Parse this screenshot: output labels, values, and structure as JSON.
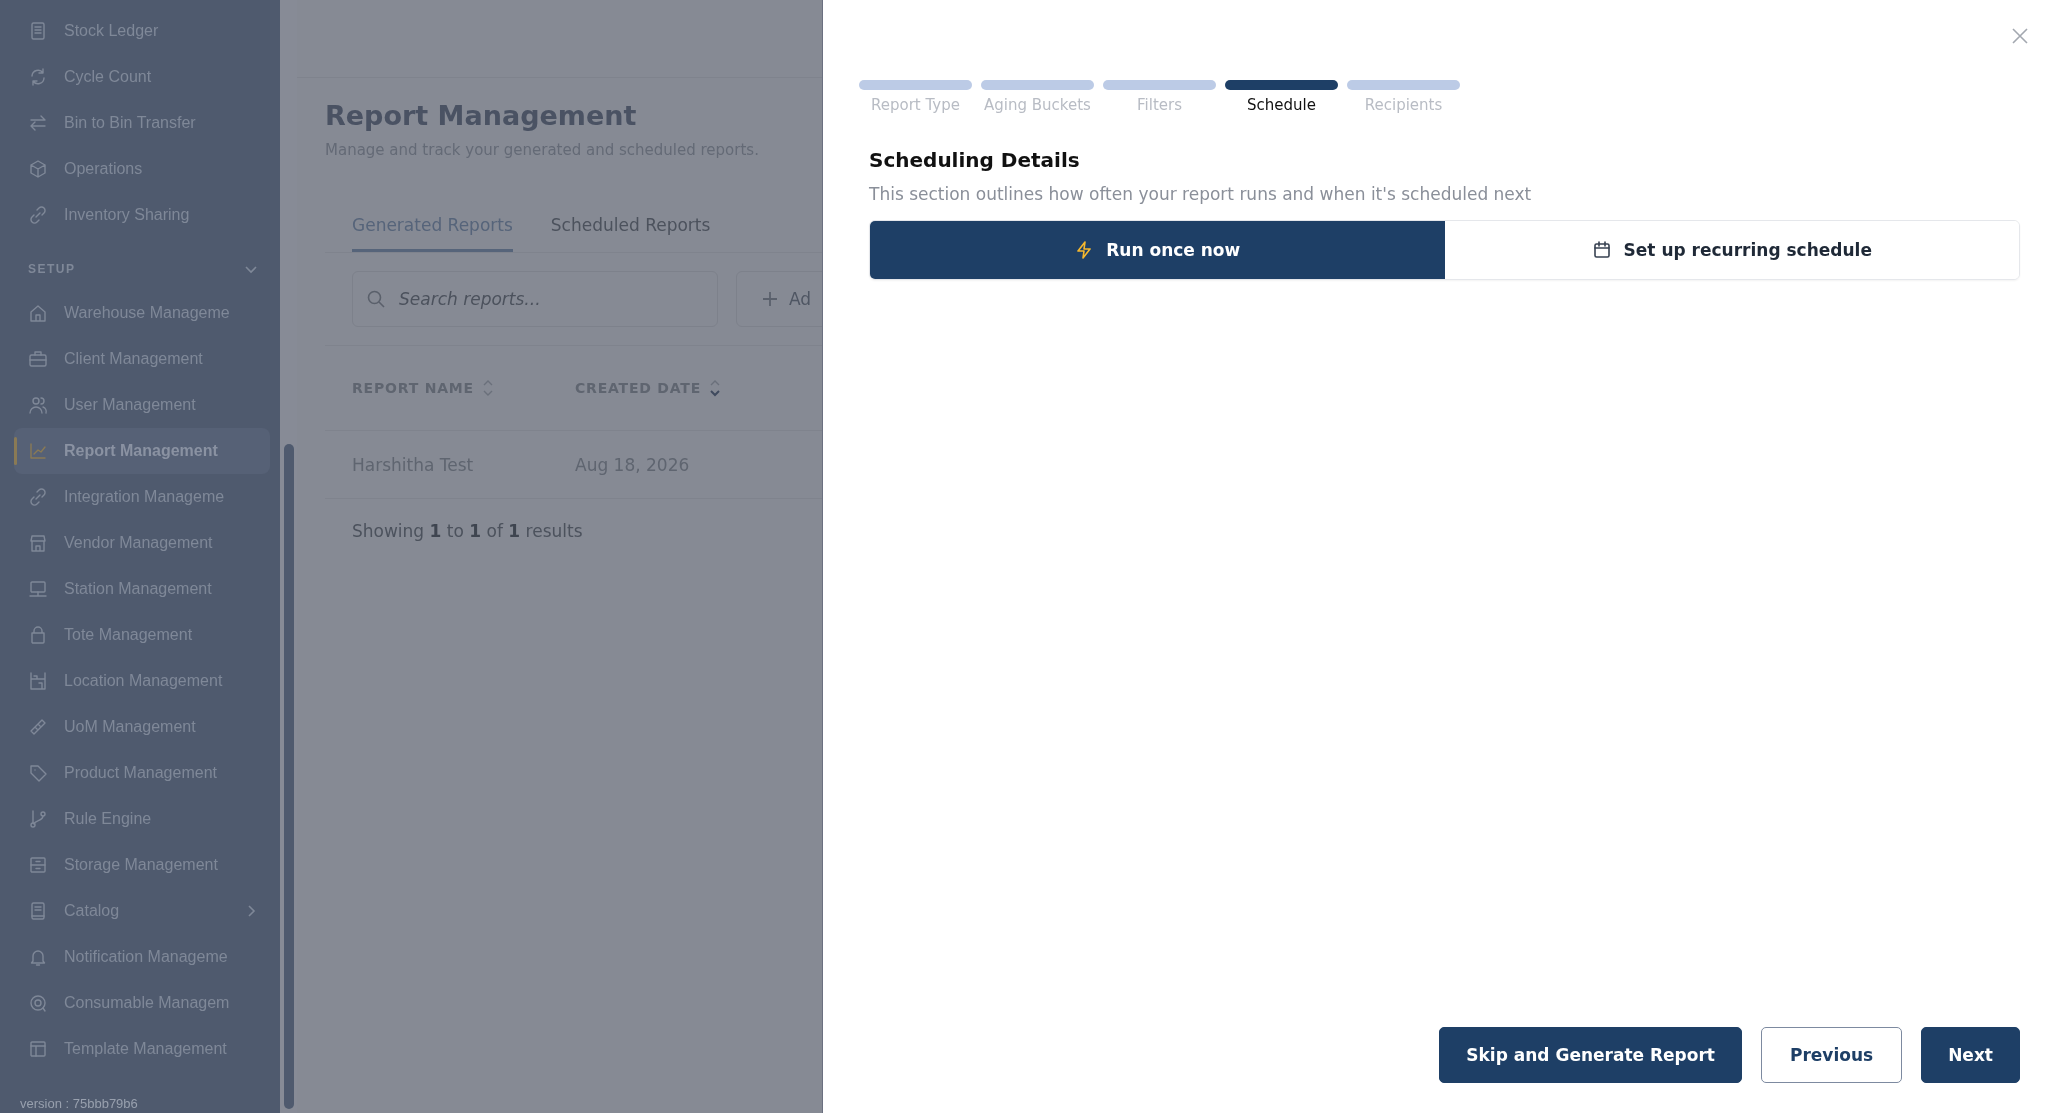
{
  "sidebar": {
    "sections": [
      {
        "items": [
          {
            "label": "Stock Ledger",
            "selected": false,
            "expandable": false
          },
          {
            "label": "Cycle Count",
            "selected": false,
            "expandable": false
          },
          {
            "label": "Bin to Bin Transfer",
            "selected": false,
            "expandable": false
          },
          {
            "label": "Operations",
            "selected": false,
            "expandable": false
          },
          {
            "label": "Inventory Sharing",
            "selected": false,
            "expandable": false
          }
        ]
      },
      {
        "title": "SETUP",
        "expanded": true,
        "items": [
          {
            "label": "Warehouse Manageme",
            "selected": false,
            "expandable": false
          },
          {
            "label": "Client Management",
            "selected": false,
            "expandable": false
          },
          {
            "label": "User Management",
            "selected": false,
            "expandable": false
          },
          {
            "label": "Report Management",
            "selected": true,
            "expandable": false
          },
          {
            "label": "Integration Manageme",
            "selected": false,
            "expandable": false
          },
          {
            "label": "Vendor Management",
            "selected": false,
            "expandable": false
          },
          {
            "label": "Station Management",
            "selected": false,
            "expandable": false
          },
          {
            "label": "Tote Management",
            "selected": false,
            "expandable": false
          },
          {
            "label": "Location Management",
            "selected": false,
            "expandable": false
          },
          {
            "label": "UoM Management",
            "selected": false,
            "expandable": false
          },
          {
            "label": "Product Management",
            "selected": false,
            "expandable": false
          },
          {
            "label": "Rule Engine",
            "selected": false,
            "expandable": false
          },
          {
            "label": "Storage Management",
            "selected": false,
            "expandable": false
          },
          {
            "label": "Catalog",
            "selected": false,
            "expandable": true
          },
          {
            "label": "Notification Manageme",
            "selected": false,
            "expandable": false
          },
          {
            "label": "Consumable Managem",
            "selected": false,
            "expandable": false
          },
          {
            "label": "Template Management",
            "selected": false,
            "expandable": false
          }
        ]
      }
    ],
    "version": "version : 75bbb79b6"
  },
  "page": {
    "title": "Report Management",
    "subtitle": "Manage and track your generated and scheduled reports.",
    "tabs": [
      {
        "label": "Generated Reports",
        "selected": true
      },
      {
        "label": "Scheduled Reports",
        "selected": false
      }
    ],
    "search": {
      "placeholder": "Search reports..."
    },
    "add_button": "Ad",
    "table": {
      "columns": [
        {
          "label": "REPORT NAME",
          "sorted": false
        },
        {
          "label": "CREATED DATE",
          "sorted": true
        }
      ],
      "rows": [
        [
          "Harshitha Test",
          "Aug 18, 2026"
        ]
      ]
    },
    "footer": "Showing **1** to **1** of **1** results"
  },
  "dialog": {
    "steps": [
      {
        "label": "Report Type",
        "selected": false
      },
      {
        "label": "Aging Buckets",
        "selected": false
      },
      {
        "label": "Filters",
        "selected": false
      },
      {
        "label": "Schedule",
        "selected": true
      },
      {
        "label": "Recipients",
        "selected": false
      }
    ],
    "title": "Scheduling Details",
    "subtitle": "This section outlines how often your report runs and when it's scheduled next",
    "options": [
      {
        "label": "Run once now",
        "kind": "once",
        "selected": true
      },
      {
        "label": "Set up recurring schedule",
        "kind": "recurring",
        "selected": false
      }
    ],
    "buttons": [
      {
        "label": "Skip and Generate Report",
        "kind": "primary"
      },
      {
        "label": "Previous",
        "kind": "secondary"
      },
      {
        "label": "Next",
        "kind": "primary"
      }
    ]
  }
}
